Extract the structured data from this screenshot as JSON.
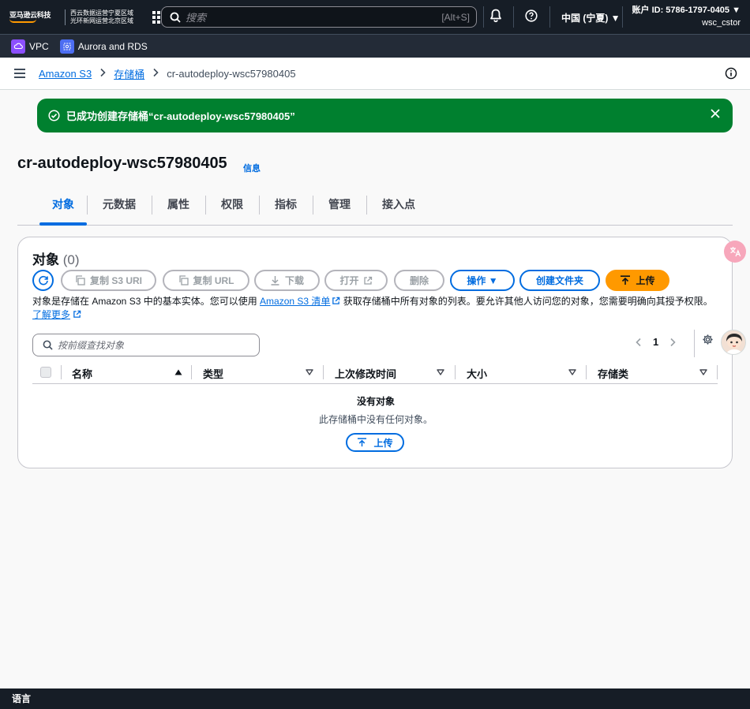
{
  "topbar": {
    "logo_text": "亚马逊云科技",
    "region_line1": "西云数据运营宁夏区域",
    "region_line2": "光环新网运营北京区域",
    "search_placeholder": "搜索",
    "search_shortcut": "[Alt+S]",
    "region_selector": "中国 (宁夏) ▼",
    "account_id": "账户 ID: 5786-1797-0405 ▼",
    "username": "wsc_cstor"
  },
  "shortcuts": [
    {
      "label": "VPC",
      "icon": "vpc-icon"
    },
    {
      "label": "Aurora and RDS",
      "icon": "rds-icon"
    }
  ],
  "breadcrumb": {
    "items": [
      "Amazon S3",
      "存储桶"
    ],
    "current": "cr-autodeploy-wsc57980405"
  },
  "flash": {
    "message": "已成功创建存储桶“cr-autodeploy-wsc57980405”",
    "type": "success",
    "color": "#00802f"
  },
  "page": {
    "title": "cr-autodeploy-wsc57980405",
    "info_link": "信息"
  },
  "tabs": [
    "对象",
    "元数据",
    "属性",
    "权限",
    "指标",
    "管理",
    "接入点"
  ],
  "active_tab": "对象",
  "objects": {
    "title": "对象",
    "count": "(0)",
    "buttons": {
      "copy_s3_uri": "复制 S3 URI",
      "copy_url": "复制 URL",
      "download": "下载",
      "open": "打开",
      "delete": "删除",
      "actions": "操作 ▼",
      "create_folder": "创建文件夹",
      "upload": "上传"
    },
    "description_part1": "对象是存储在 Amazon S3 中的基本实体。您可以使用 ",
    "inventory_link": "Amazon S3 清单",
    "description_part2": " 获取存储桶中所有对象的列表。要允许其他人访问您的对象，您需要明确向其授予权限。",
    "learn_more": "了解更多",
    "filter_placeholder": "按前缀查找对象",
    "page_number": "1",
    "columns": [
      "名称",
      "类型",
      "上次修改时间",
      "大小",
      "存储类"
    ],
    "empty_title": "没有对象",
    "empty_desc": "此存储桶中没有任何对象。",
    "empty_upload": "上传"
  },
  "footer": {
    "language": "语言"
  },
  "colors": {
    "accent": "#006ce0",
    "primary_button": "#ff9900",
    "topbar": "#161d26"
  }
}
